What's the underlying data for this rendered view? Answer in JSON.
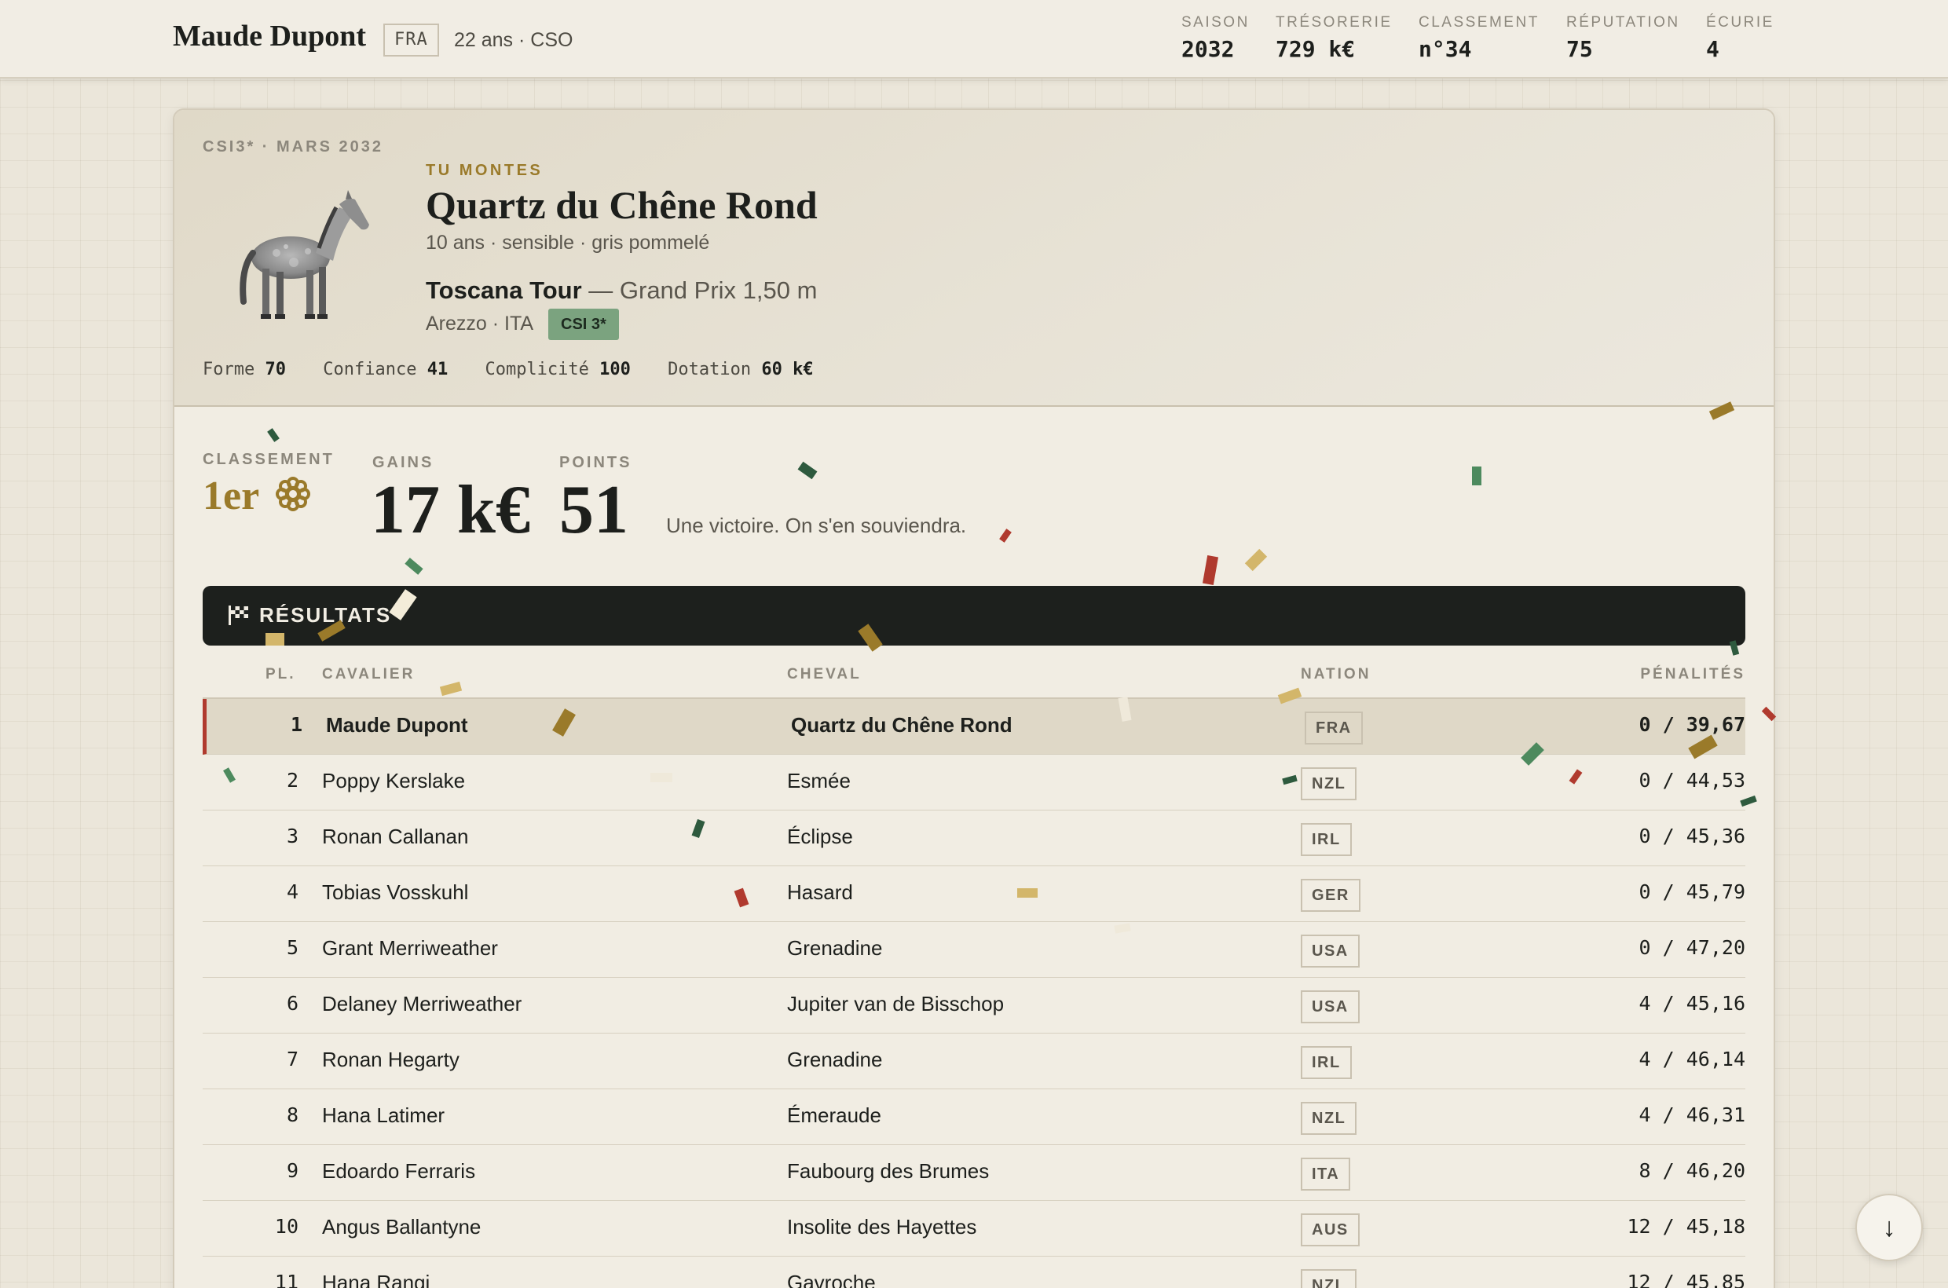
{
  "player": {
    "name": "Maude Dupont",
    "nation": "FRA",
    "meta": "22 ans · CSO"
  },
  "stats": [
    {
      "label": "SAISON",
      "value": "2032"
    },
    {
      "label": "TRÉSORERIE",
      "value": "729 k€"
    },
    {
      "label": "CLASSEMENT",
      "value": "n°34"
    },
    {
      "label": "RÉPUTATION",
      "value": "75"
    },
    {
      "label": "ÉCURIE",
      "value": "4"
    }
  ],
  "event": {
    "date": "CSI3* · MARS 2032",
    "you_ride_label": "TU MONTES",
    "horse_name": "Quartz du Chêne Rond",
    "horse_meta": "10 ans · sensible · gris pommelé",
    "tour_name": "Toscana Tour",
    "tour_detail": " — Grand Prix 1,50 m",
    "location": "Arezzo · ITA",
    "badge": "CSI 3*",
    "horse_stats": [
      {
        "label": "Forme",
        "value": "70"
      },
      {
        "label": "Confiance",
        "value": "41"
      },
      {
        "label": "Complicité",
        "value": "100"
      },
      {
        "label": "Dotation",
        "value": "60 k€"
      }
    ]
  },
  "summary": {
    "rank_label": "CLASSEMENT",
    "rank_value": "1er",
    "rank_icon": "rosette-icon",
    "gains_label": "GAINS",
    "gains_value": "17 k€",
    "points_label": "POINTS",
    "points_value": "51",
    "message": "Une victoire. On s'en souviendra."
  },
  "results": {
    "title": "RÉSULTATS",
    "icon": "checkered-flag-icon",
    "columns": {
      "pl": "PL.",
      "rider": "CAVALIER",
      "horse": "CHEVAL",
      "nation": "NATION",
      "penalties": "PÉNALITÉS"
    },
    "rows": [
      {
        "pl": "1",
        "rider": "Maude Dupont",
        "horse": "Quartz du Chêne Rond",
        "nation": "FRA",
        "penalties": "0 / 39,67"
      },
      {
        "pl": "2",
        "rider": "Poppy Kerslake",
        "horse": "Esmée",
        "nation": "NZL",
        "penalties": "0 / 44,53"
      },
      {
        "pl": "3",
        "rider": "Ronan Callanan",
        "horse": "Éclipse",
        "nation": "IRL",
        "penalties": "0 / 45,36"
      },
      {
        "pl": "4",
        "rider": "Tobias Vosskuhl",
        "horse": "Hasard",
        "nation": "GER",
        "penalties": "0 / 45,79"
      },
      {
        "pl": "5",
        "rider": "Grant Merriweather",
        "horse": "Grenadine",
        "nation": "USA",
        "penalties": "0 / 47,20"
      },
      {
        "pl": "6",
        "rider": "Delaney Merriweather",
        "horse": "Jupiter van de Bisschop",
        "nation": "USA",
        "penalties": "4 / 45,16"
      },
      {
        "pl": "7",
        "rider": "Ronan Hegarty",
        "horse": "Grenadine",
        "nation": "IRL",
        "penalties": "4 / 46,14"
      },
      {
        "pl": "8",
        "rider": "Hana Latimer",
        "horse": "Émeraude",
        "nation": "NZL",
        "penalties": "4 / 46,31"
      },
      {
        "pl": "9",
        "rider": "Edoardo Ferraris",
        "horse": "Faubourg des Brumes",
        "nation": "ITA",
        "penalties": "8 / 46,20"
      },
      {
        "pl": "10",
        "rider": "Angus Ballantyne",
        "horse": "Insolite des Hayettes",
        "nation": "AUS",
        "penalties": "12 / 45,18"
      },
      {
        "pl": "11",
        "rider": "Hana Rangi",
        "horse": "Gavroche",
        "nation": "NZL",
        "penalties": "12 / 45,85"
      }
    ]
  },
  "scroll_button": {
    "icon": "arrow-down-icon",
    "glyph": "↓"
  },
  "colors": {
    "accent_gold": "#9a7a2a",
    "badge_green": "#7ba37f",
    "highlight_red": "#b03a2e",
    "dark_bar": "#1d201d",
    "background": "#ebe6da"
  }
}
